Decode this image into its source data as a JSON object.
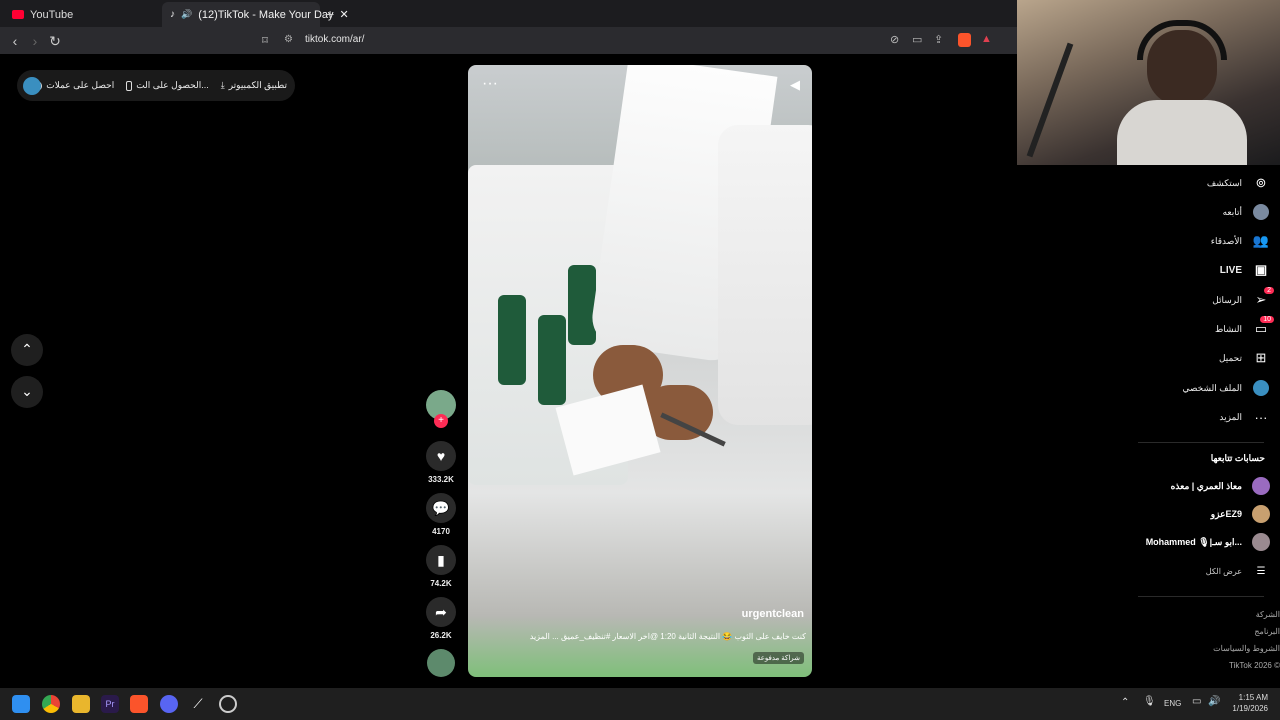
{
  "browser": {
    "tabs": [
      {
        "title": "YouTube",
        "icon": "youtube-icon",
        "active": false
      },
      {
        "title": "(12)TikTok - Make Your Day",
        "icon": "tiktok-icon",
        "active": true
      }
    ],
    "url": "tiktok.com/ar/"
  },
  "top_pill": {
    "get_coins": "احصل على عملات",
    "get_app": "الحصول على الت...",
    "desktop_app": "تطبيق الكمبيوتر"
  },
  "video": {
    "author": "urgentclean",
    "caption": "كنت خايف على الثوب 😂 النتيجة الثانية 1:20 @اخر الاسعار #تنظيف_عميق ... المزيد",
    "paid_partnership": "شراكة مدفوعة"
  },
  "actions": {
    "likes": "333.2K",
    "comments": "4170",
    "saves": "74.2K",
    "shares": "26.2K"
  },
  "sidebar": {
    "items": [
      {
        "label": "استكشف",
        "icon": "compass-icon"
      },
      {
        "label": "أتابعه",
        "icon": "avatar-icon"
      },
      {
        "label": "الأصدقاء",
        "icon": "friends-icon"
      },
      {
        "label": "LIVE",
        "icon": "live-icon"
      },
      {
        "label": "الرسائل",
        "icon": "send-icon",
        "badge": "2"
      },
      {
        "label": "النشاط",
        "icon": "activity-icon",
        "badge": "10"
      },
      {
        "label": "تحميل",
        "icon": "upload-icon"
      },
      {
        "label": "الملف الشخصي",
        "icon": "profile-icon"
      },
      {
        "label": "المزيد",
        "icon": "more-icon"
      }
    ],
    "following_title": "حسابات تتابعها",
    "following": [
      {
        "name": "معاذ العمري | معذه"
      },
      {
        "name": "عزوEZ9"
      },
      {
        "name": "Mohammed 🎙|ابو سـ..."
      }
    ],
    "see_all": "عرض الكل",
    "footer": [
      "الشركة",
      "البرنامج",
      "الشروط والسياسات",
      "TikTok 2026 ©"
    ]
  },
  "taskbar": {
    "lang": "ENG",
    "time": "1:15 AM",
    "date": "1/19/2026"
  }
}
